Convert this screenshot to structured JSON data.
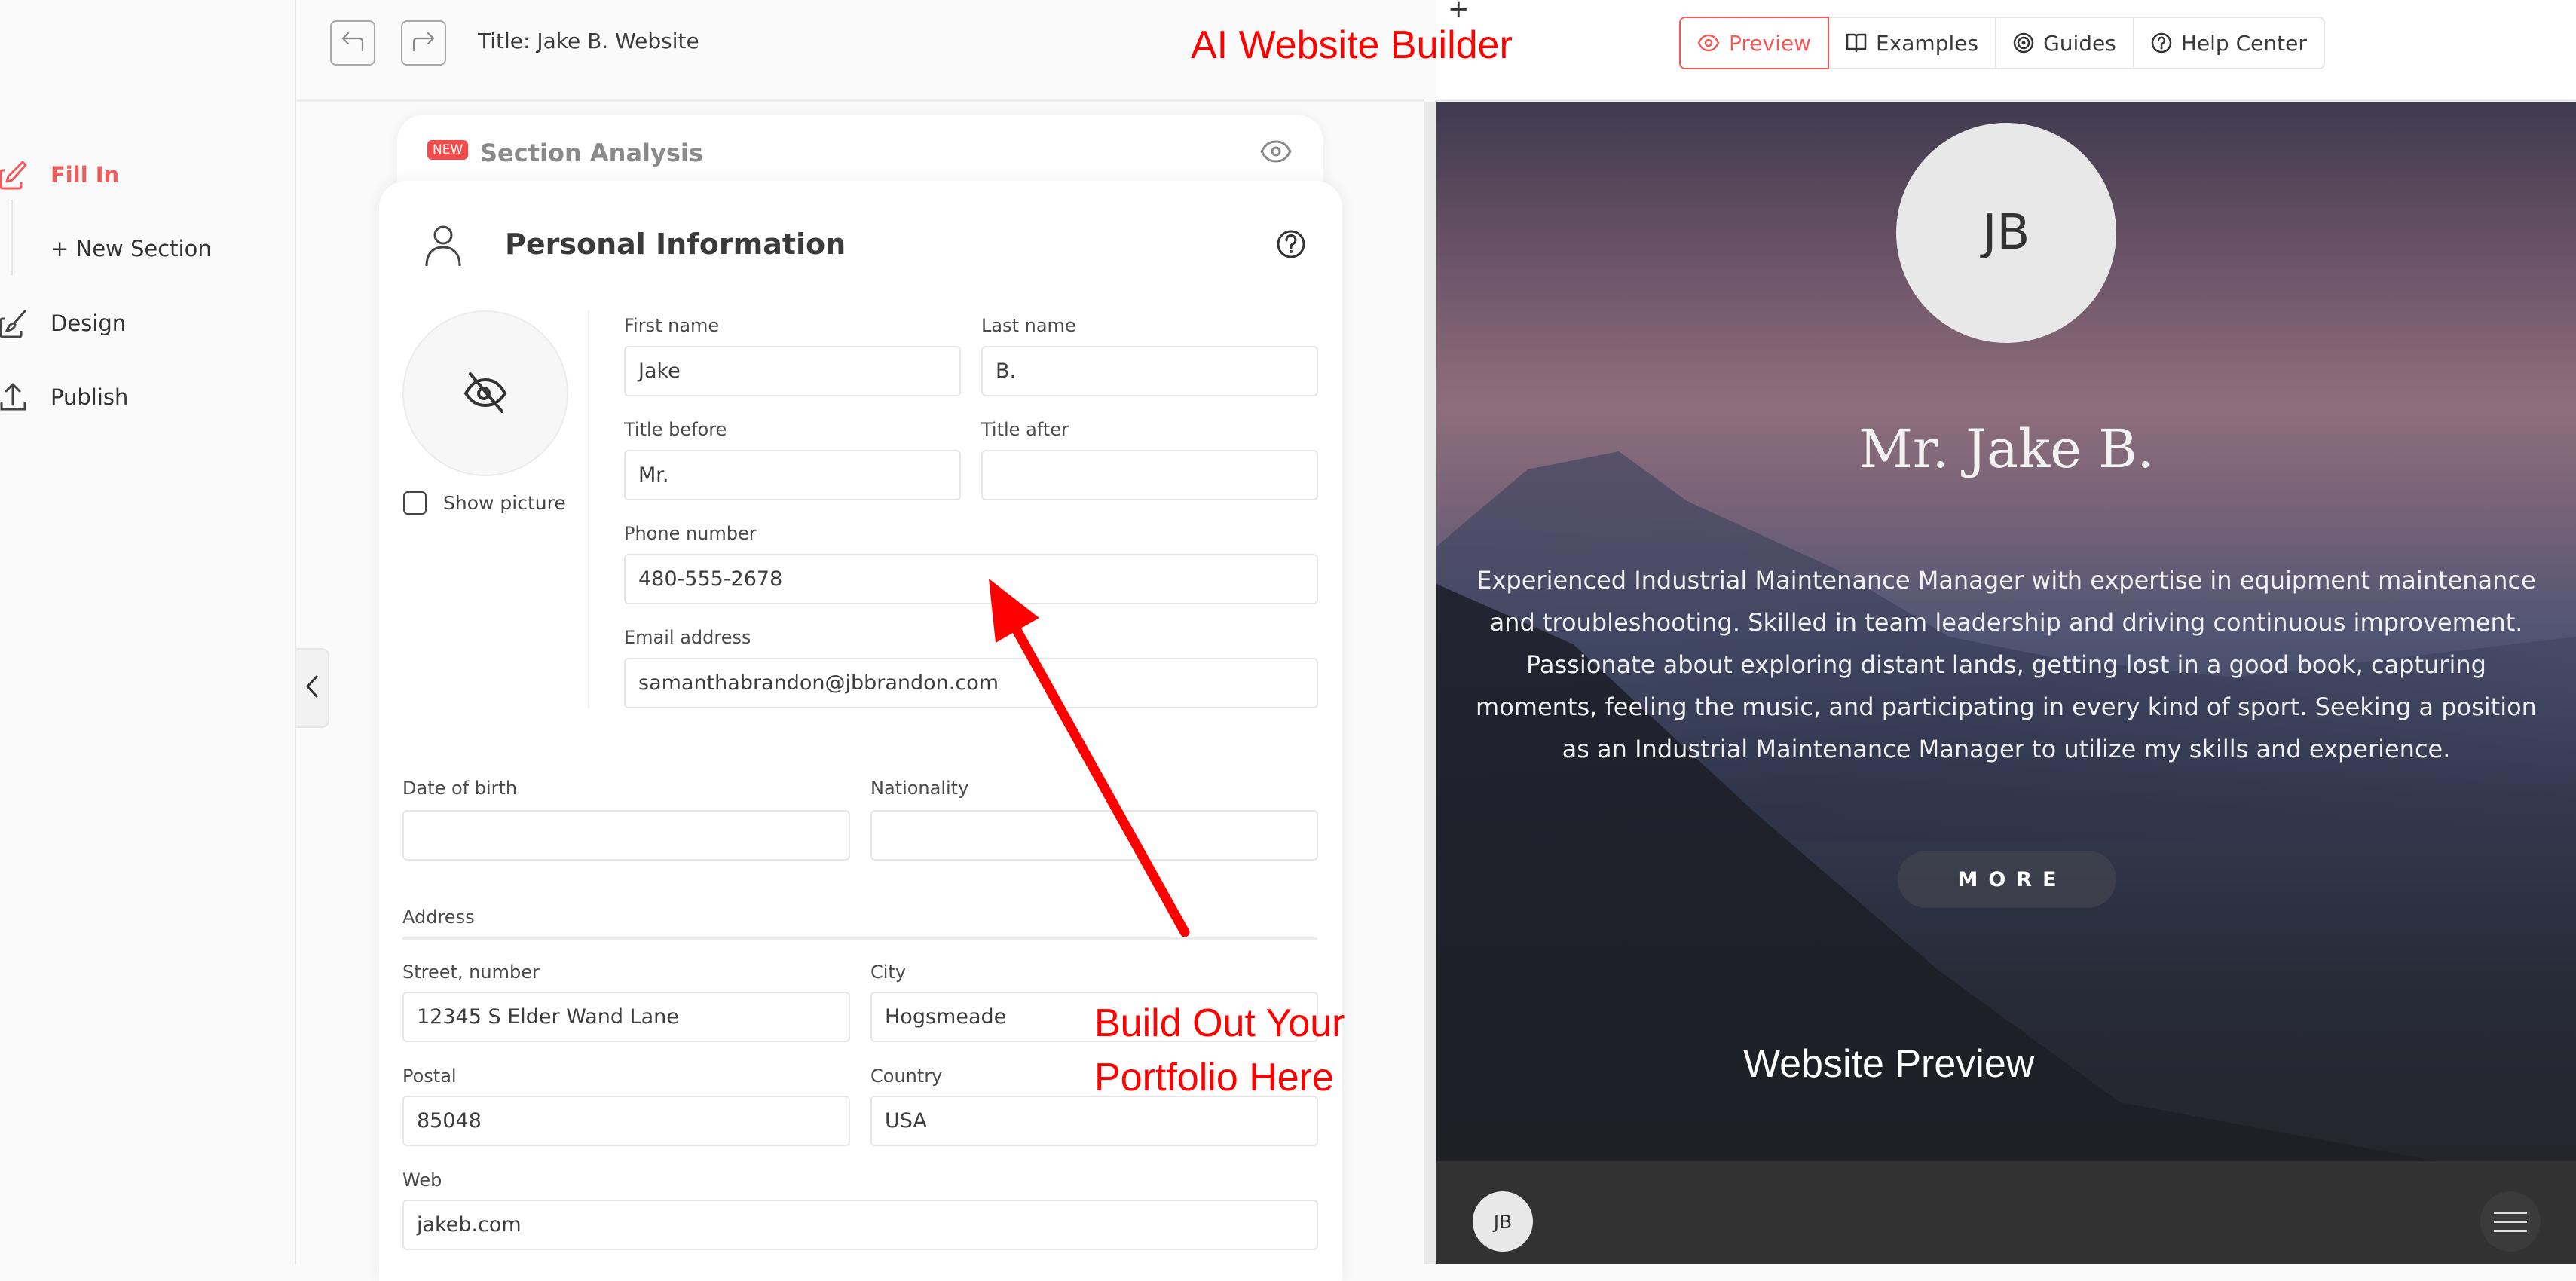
{
  "app": {
    "title_label": "Title: Jake B. Website",
    "history": {
      "undo_icon": "undo-arrow-icon",
      "redo_icon": "redo-arrow-icon"
    }
  },
  "sidebar": {
    "items": [
      {
        "label": "Fill In",
        "icon": "pencil-square-icon",
        "active": true
      },
      {
        "label": "+ New Section",
        "icon": "",
        "active": false
      },
      {
        "label": "Design",
        "icon": "brush-square-icon",
        "active": false
      },
      {
        "label": "Publish",
        "icon": "upload-icon",
        "active": false
      }
    ]
  },
  "top_tabs": [
    {
      "label": "Preview",
      "icon": "eye-icon",
      "active": true
    },
    {
      "label": "Examples",
      "icon": "book-icon",
      "active": false
    },
    {
      "label": "Guides",
      "icon": "target-icon",
      "active": false
    },
    {
      "label": "Help Center",
      "icon": "help-circle-icon",
      "active": false
    }
  ],
  "section_analysis": {
    "badge": "NEW",
    "title": "Section Analysis"
  },
  "personal_info": {
    "title": "Personal Information",
    "show_picture_label": "Show picture",
    "show_picture_checked": false,
    "fields": {
      "first_name": {
        "label": "First name",
        "value": "Jake"
      },
      "last_name": {
        "label": "Last name",
        "value": "B."
      },
      "title_before": {
        "label": "Title before",
        "value": "Mr."
      },
      "title_after": {
        "label": "Title after",
        "value": ""
      },
      "phone": {
        "label": "Phone number",
        "value": "480-555-2678"
      },
      "email": {
        "label": "Email address",
        "value": "samanthabrandon@jbbrandon.com"
      },
      "dob": {
        "label": "Date of birth",
        "value": ""
      },
      "nationality": {
        "label": "Nationality",
        "value": ""
      },
      "address_heading": "Address",
      "street": {
        "label": "Street, number",
        "value": "12345 S Elder Wand Lane"
      },
      "city": {
        "label": "City",
        "value": "Hogsmeade"
      },
      "postal": {
        "label": "Postal",
        "value": "85048"
      },
      "country": {
        "label": "Country",
        "value": "USA"
      },
      "web": {
        "label": "Web",
        "value": "jakeb.com"
      }
    }
  },
  "site_preview": {
    "initials": "JB",
    "name": "Mr. Jake B.",
    "bio": "Experienced Industrial Maintenance Manager with expertise in equipment maintenance and troubleshooting. Skilled in team leadership and driving continuous improvement. Passionate about exploring distant lands, getting lost in a good book, capturing moments, feeling the music, and participating in every kind of sport. Seeking a position as an Industrial Maintenance Manager to utilize my skills and experience.",
    "more_label": "MORE",
    "footer_initials": "JB"
  },
  "annotations": {
    "heading": "AI Website Builder",
    "build_line1": "Build Out Your",
    "build_line2": "Portfolio Here",
    "preview_label": "Website Preview"
  },
  "colors": {
    "accent": "#f05a5a",
    "annotation": "#ff0000",
    "footer": "#323232"
  }
}
